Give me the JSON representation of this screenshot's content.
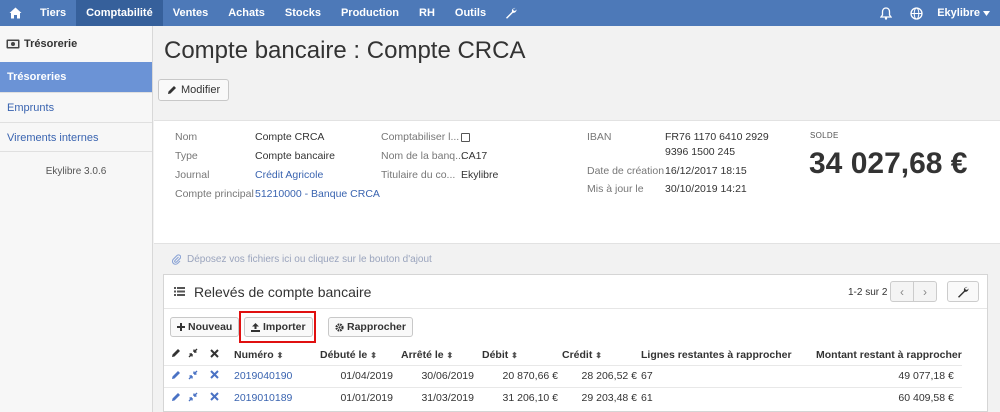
{
  "topnav": {
    "items": [
      "Tiers",
      "Comptabilité",
      "Ventes",
      "Achats",
      "Stocks",
      "Production",
      "RH",
      "Outils"
    ],
    "active": "Comptabilité",
    "user": "Ekylibre"
  },
  "sidebar": {
    "section": "Trésorerie",
    "items": [
      {
        "label": "Trésoreries",
        "active": true
      },
      {
        "label": "Emprunts",
        "active": false
      },
      {
        "label": "Virements internes",
        "active": false
      }
    ],
    "version": "Ekylibre 3.0.6"
  },
  "page": {
    "title": "Compte bancaire : Compte CRCA",
    "modifier_label": "Modifier"
  },
  "info": {
    "col1": [
      {
        "k": "Nom",
        "v": "Compte CRCA"
      },
      {
        "k": "Type",
        "v": "Compte bancaire"
      },
      {
        "k": "Journal",
        "v": "Crédit Agricole"
      },
      {
        "k": "Compte principal",
        "v": "51210000 - Banque CRCA"
      }
    ],
    "col2": [
      {
        "k": "Comptabiliser l...",
        "v": ""
      },
      {
        "k": "Nom de la banq...",
        "v": "CA17"
      },
      {
        "k": "Titulaire du co...",
        "v": "Ekylibre"
      }
    ],
    "col3": [
      {
        "k": "IBAN",
        "v": "FR76 1170 6410 2929",
        "v2": "9396 1500 245"
      },
      {
        "k": "Date de création",
        "v": "16/12/2017 18:15"
      },
      {
        "k": "Mis à jour le",
        "v": "30/10/2019 14:21"
      }
    ],
    "solde_label": "SOLDE",
    "solde_value": "34 027,68 €"
  },
  "dropzone": "Déposez vos fichiers ici ou cliquez sur le bouton d'ajout",
  "panel": {
    "title": "Relevés de compte bancaire",
    "pager": "1-2 sur 2",
    "buttons": {
      "new": "Nouveau",
      "import": "Importer",
      "reconcile": "Rapprocher"
    },
    "columns": [
      "Numéro",
      "Débuté le",
      "Arrêté le",
      "Débit",
      "Crédit",
      "Lignes restantes à rapprocher",
      "Montant restant à rapprocher"
    ],
    "rows": [
      {
        "numero": "2019040190",
        "debut": "01/04/2019",
        "arrete": "30/06/2019",
        "debit": "20 870,66 €",
        "credit": "28 206,52 €",
        "lignes": "67",
        "montant": "49 077,18 €"
      },
      {
        "numero": "2019010189",
        "debut": "01/01/2019",
        "arrete": "31/03/2019",
        "debit": "31 206,10 €",
        "credit": "29 203,48 €",
        "lignes": "61",
        "montant": "60 409,58 €"
      }
    ]
  },
  "colors": {
    "nav": "#4d79b8",
    "nav_active": "#36609b",
    "sidebar_active": "#6b93d6",
    "link": "#3a64b0",
    "highlight": "#e01010"
  }
}
